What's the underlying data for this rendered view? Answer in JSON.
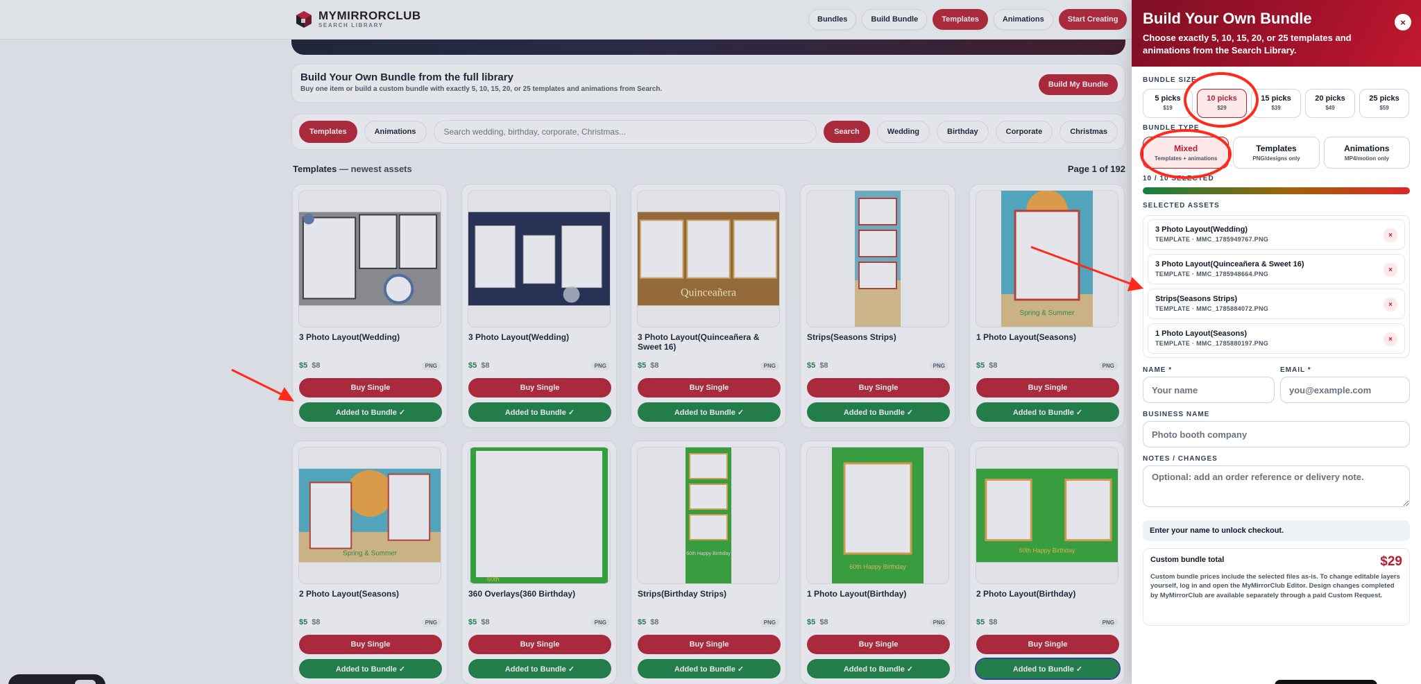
{
  "header": {
    "brand": "MYMIRRORCLUB",
    "brand_sub": "SEARCH LIBRARY",
    "nav": [
      "Bundles",
      "Build Bundle",
      "Templates",
      "Animations",
      "Start Creating"
    ]
  },
  "banner": {
    "title": "Build Your Own Bundle from the full library",
    "subtitle": "Buy one item or build a custom bundle with exactly 5, 10, 15, 20, or 25 templates and animations from Search.",
    "button": "Build My Bundle"
  },
  "filters": {
    "tabs": [
      "Templates",
      "Animations"
    ],
    "search_placeholder": "Search wedding, birthday, corporate, Christmas...",
    "search_button": "Search",
    "tags": [
      "Wedding",
      "Birthday",
      "Corporate",
      "Christmas"
    ]
  },
  "section": {
    "title": "Templates",
    "subtitle": "— newest assets",
    "page": "Page 1 of 192"
  },
  "card_labels": {
    "price_now": "$5",
    "price_was": "$8",
    "format": "PNG",
    "buy": "Buy Single",
    "added": "Added to Bundle ✓"
  },
  "cards": [
    {
      "title": "3 Photo Layout(Wedding)",
      "thumb": "wedding-gray"
    },
    {
      "title": "3 Photo Layout(Wedding)",
      "thumb": "wedding-navy"
    },
    {
      "title": "3 Photo Layout(Quinceañera & Sweet 16)",
      "thumb": "quince",
      "thumb_text": "Quinceañera"
    },
    {
      "title": "Strips(Seasons Strips)",
      "thumb": "strip-beach"
    },
    {
      "title": "1 Photo Layout(Seasons)",
      "thumb": "single-beach",
      "thumb_text": "Spring & Summer"
    },
    {
      "title": "2 Photo Layout(Seasons)",
      "thumb": "double-beach",
      "thumb_text": "Spring & Summer"
    },
    {
      "title": "360 Overlays(360 Birthday)",
      "thumb": "overlay-green",
      "thumb_text": "60th"
    },
    {
      "title": "Strips(Birthday Strips)",
      "thumb": "strip-green",
      "thumb_text": "60th Happy Birthday"
    },
    {
      "title": "1 Photo Layout(Birthday)",
      "thumb": "single-green",
      "thumb_text": "60th Happy Birthday"
    },
    {
      "title": "2 Photo Layout(Birthday)",
      "thumb": "double-green",
      "thumb_text": "60th Happy Birthday"
    }
  ],
  "drawer": {
    "title": "Build Your Own Bundle",
    "subtitle": "Choose exactly 5, 10, 15, 20, or 25 templates and animations from the Search Library.",
    "close": "×",
    "size_label": "Bundle Size",
    "sizes": [
      {
        "picks": "5 picks",
        "price": "$19"
      },
      {
        "picks": "10 picks",
        "price": "$29"
      },
      {
        "picks": "15 picks",
        "price": "$39"
      },
      {
        "picks": "20 picks",
        "price": "$49"
      },
      {
        "picks": "25 picks",
        "price": "$59"
      }
    ],
    "selected_size": "10 picks",
    "type_label": "Bundle Type",
    "types": [
      {
        "name": "Mixed",
        "desc": "Templates + animations"
      },
      {
        "name": "Templates",
        "desc": "PNG/designs only"
      },
      {
        "name": "Animations",
        "desc": "MP4/motion only"
      }
    ],
    "selected_type": "Mixed",
    "count_label": "10 / 10 Selected",
    "progress": 1.0,
    "assets_label": "Selected Assets",
    "assets": [
      {
        "name": "3 Photo Layout(Wedding)",
        "meta": "TEMPLATE · MMC_1785949767.PNG"
      },
      {
        "name": "3 Photo Layout(Quinceañera & Sweet 16)",
        "meta": "TEMPLATE · MMC_1785948664.PNG"
      },
      {
        "name": "Strips(Seasons Strips)",
        "meta": "TEMPLATE · MMC_1785884072.PNG"
      },
      {
        "name": "1 Photo Layout(Seasons)",
        "meta": "TEMPLATE · MMC_1785880197.PNG"
      }
    ],
    "remove": "×",
    "name_label": "Name *",
    "name_placeholder": "Your name",
    "email_label": "Email *",
    "email_placeholder": "you@example.com",
    "business_label": "Business Name",
    "business_placeholder": "Photo booth company",
    "notes_label": "Notes / Changes",
    "notes_placeholder": "Optional: add an order reference or delivery note.",
    "notice": "Enter your name to unlock checkout.",
    "total_label": "Custom bundle total",
    "total_value": "$29",
    "total_note": "Custom bundle prices include the selected files as-is. To change editable layers yourself, log in and open the MyMirrorClub Editor. Design changes completed by MyMirrorClub are available separately through a paid Custom Request."
  },
  "colors": {
    "brand_red": "#b91c2c",
    "success_green": "#15803d",
    "annotation_red": "#ff2a1a"
  }
}
